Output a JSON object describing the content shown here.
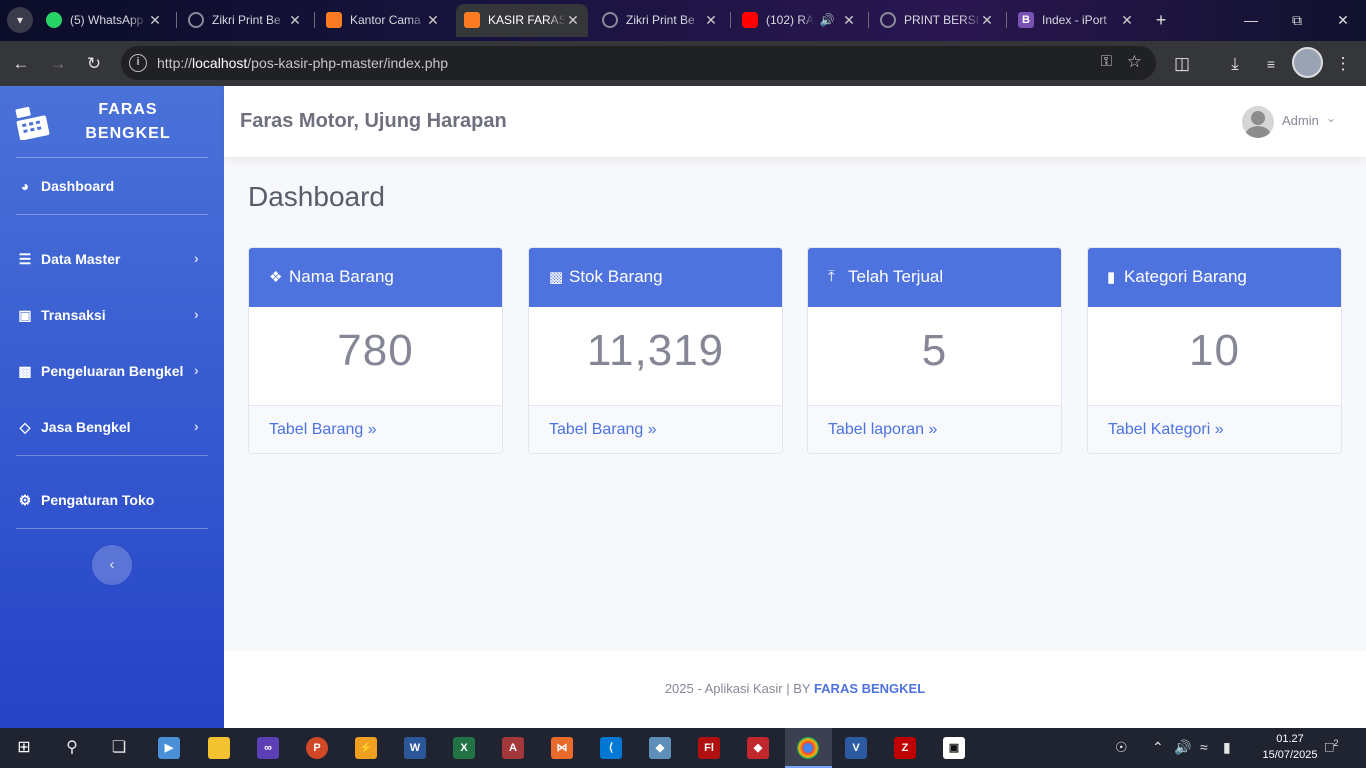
{
  "browser": {
    "tabs": [
      {
        "title": "(5) WhatsApp",
        "favicon": "whatsapp-icon",
        "color": "#25d366"
      },
      {
        "title": "Zikri Print Be",
        "favicon": "globe-icon",
        "color": "#8a8a9a"
      },
      {
        "title": "Kantor Cama",
        "favicon": "xampp-icon",
        "color": "#fb7a24"
      },
      {
        "title": "KASIR FARAS",
        "favicon": "xampp-icon",
        "color": "#fb7a24"
      },
      {
        "title": "Zikri Print Be",
        "favicon": "globe-icon",
        "color": "#8a8a9a"
      },
      {
        "title": "(102) RA",
        "favicon": "youtube-icon",
        "color": "#ff0000"
      },
      {
        "title": "PRINT BERSI",
        "favicon": "globe-icon",
        "color": "#8a8a9a"
      },
      {
        "title": "Index - iPort",
        "favicon": "bootstrap-icon",
        "color": "#7952b3"
      }
    ],
    "url_prefix": "http://",
    "url_host": "localhost",
    "url_path": "/pos-kasir-php-master/index.php"
  },
  "sidebar": {
    "brand_line1": "FARAS",
    "brand_line2": "BENGKEL",
    "items": [
      {
        "label": "Dashboard",
        "icon": "tachometer-icon"
      },
      {
        "label": "Data Master",
        "icon": "database-icon"
      },
      {
        "label": "Transaksi",
        "icon": "desktop-icon"
      },
      {
        "label": "Pengeluaran Bengkel",
        "icon": "money-icon"
      },
      {
        "label": "Jasa Bengkel",
        "icon": "layers-icon"
      },
      {
        "label": "Pengaturan Toko",
        "icon": "cogs-icon"
      }
    ]
  },
  "topbar": {
    "shop_title": "Faras Motor, Ujung Harapan",
    "user_name": "Admin"
  },
  "main": {
    "page_title": "Dashboard",
    "cards": [
      {
        "title": "Nama Barang",
        "value": "780",
        "link": "Tabel Barang",
        "icon": "cubes-icon"
      },
      {
        "title": "Stok Barang",
        "value": "11,319",
        "link": "Tabel Barang",
        "icon": "bar-chart-icon"
      },
      {
        "title": "Telah Terjual",
        "value": "5",
        "link": "Tabel laporan",
        "icon": "upload-icon"
      },
      {
        "title": "Kategori Barang",
        "value": "10",
        "link": "Tabel Kategori",
        "icon": "bookmark-icon"
      }
    ]
  },
  "footer": {
    "text": "2025 - Aplikasi Kasir | BY",
    "brand": "FARAS BENGKEL"
  },
  "taskbar": {
    "time": "01.27",
    "date": "15/07/2025",
    "notification_count": "2"
  },
  "colors": {
    "primary": "#4e73df",
    "sidebar_top": "#4b72d9",
    "sidebar_bottom": "#2443c6",
    "text_muted": "#858796"
  }
}
